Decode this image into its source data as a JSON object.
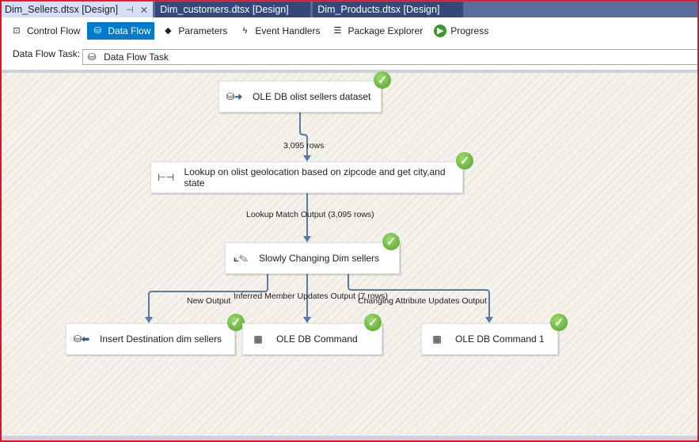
{
  "tabs": [
    {
      "label": "Dim_Sellers.dtsx [Design]",
      "active": true
    },
    {
      "label": "Dim_customers.dtsx [Design]"
    },
    {
      "label": "Dim_Products.dtsx [Design]"
    }
  ],
  "toolbar": {
    "control_flow": "Control Flow",
    "data_flow": "Data Flow",
    "parameters": "Parameters",
    "event_handlers": "Event Handlers",
    "package_explorer": "Package Explorer",
    "progress": "Progress"
  },
  "task": {
    "label": "Data Flow Task:",
    "value": "Data Flow Task"
  },
  "nodes": {
    "source": "OLE DB olist sellers dataset",
    "lookup": "Lookup on olist geolocation based on zipcode and get city,and state",
    "scd": "Slowly Changing Dim sellers",
    "insert": "Insert Destination dim sellers",
    "cmd": "OLE DB Command",
    "cmd1": "OLE DB Command 1"
  },
  "paths": {
    "p1": "3,095 rows",
    "p2": "Lookup Match Output (3,095 rows)",
    "p3": "New Output",
    "p4": "Inferred Member Updates Output (7 rows)",
    "p5": "Changing Attribute Updates Output"
  },
  "colors": {
    "accent": "#007acc",
    "success": "#4ea22a",
    "path": "#5b7aa8"
  }
}
